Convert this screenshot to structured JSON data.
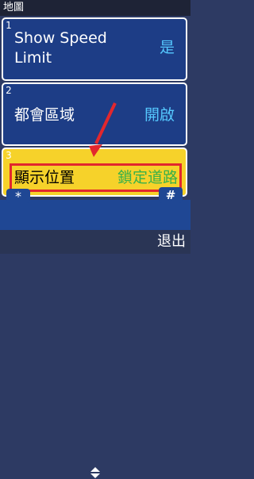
{
  "app": {
    "title": "地圖"
  },
  "menu": {
    "items": [
      {
        "number": "1",
        "label_line1": "Show Speed",
        "label_line2": "Limit",
        "value": "是"
      },
      {
        "number": "2",
        "label": "都會區域",
        "value": "開啟"
      },
      {
        "number": "3",
        "label": "顯示位置",
        "value": "鎖定道路"
      }
    ]
  },
  "keys": {
    "star": "*",
    "hash": "#"
  },
  "softkeys": {
    "right": "退出"
  },
  "icons": {
    "scroll": "scroll-up-down-icon",
    "annotation": "red-arrow-pointer"
  },
  "colors": {
    "selected_bg": "#f6d22a",
    "item_bg": "#1d3d86",
    "value_blue": "#55c8ff",
    "value_green": "#37b04a",
    "annotation_red": "#e2272d"
  }
}
